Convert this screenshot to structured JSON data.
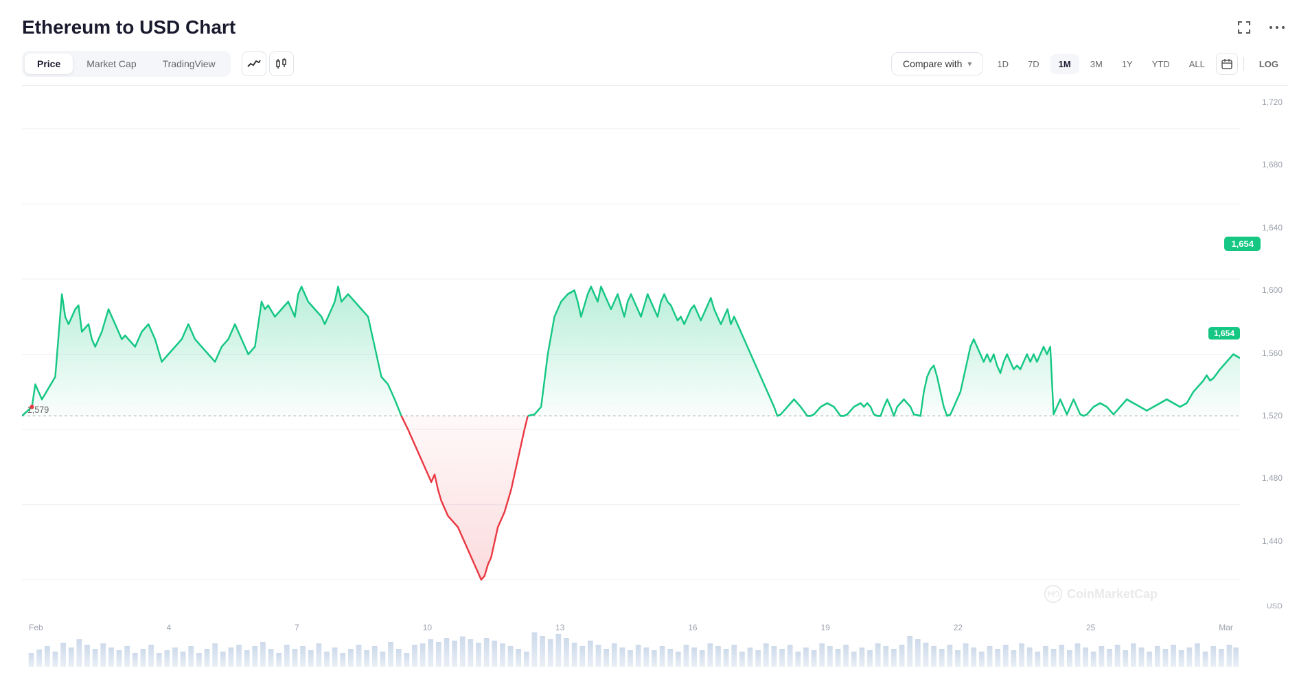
{
  "title": "Ethereum to USD Chart",
  "header_icons": {
    "expand": "⤢",
    "more": "⋯"
  },
  "tabs": [
    {
      "id": "price",
      "label": "Price",
      "active": true
    },
    {
      "id": "market_cap",
      "label": "Market Cap",
      "active": false
    },
    {
      "id": "trading_view",
      "label": "TradingView",
      "active": false
    }
  ],
  "chart_types": [
    {
      "id": "line",
      "icon": "∿",
      "label": "Line chart"
    },
    {
      "id": "candlestick",
      "icon": "⫿",
      "label": "Candlestick chart"
    }
  ],
  "compare_with": {
    "label": "Compare with",
    "chevron": "▾"
  },
  "periods": [
    {
      "id": "1d",
      "label": "1D",
      "active": false
    },
    {
      "id": "7d",
      "label": "7D",
      "active": false
    },
    {
      "id": "1m",
      "label": "1M",
      "active": true
    },
    {
      "id": "3m",
      "label": "3M",
      "active": false
    },
    {
      "id": "1y",
      "label": "1Y",
      "active": false
    },
    {
      "id": "ytd",
      "label": "YTD",
      "active": false
    },
    {
      "id": "all",
      "label": "ALL",
      "active": false
    }
  ],
  "log_label": "LOG",
  "current_price": "1,654",
  "reference_price": "1,579",
  "y_axis_labels": [
    "1,720",
    "1,680",
    "1,640",
    "1,600",
    "1,560",
    "1,520",
    "1,480",
    "1,440"
  ],
  "x_axis_labels": [
    "Feb",
    "4",
    "7",
    "10",
    "13",
    "16",
    "19",
    "22",
    "25",
    "Mar"
  ],
  "usd_label": "USD",
  "watermark": "CoinMarketCap",
  "colors": {
    "green": "#16c784",
    "red": "#ea3943",
    "green_area": "rgba(22,199,132,0.15)",
    "red_area": "rgba(234,57,67,0.12)",
    "grid": "#f0f2f5"
  }
}
